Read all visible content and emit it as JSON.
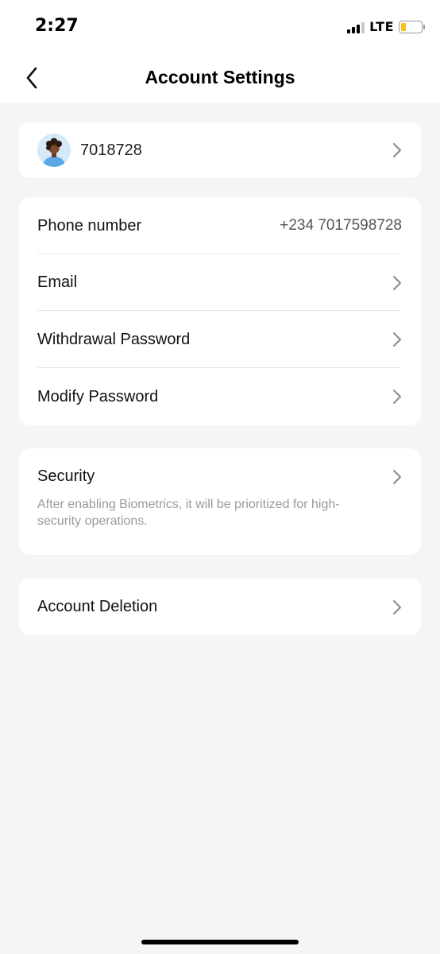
{
  "status_bar": {
    "time": "2:27",
    "network": "LTE",
    "battery_level": 0.25,
    "battery_color": "#f6c21a"
  },
  "nav": {
    "title": "Account Settings",
    "back_icon": "chevron-left-icon"
  },
  "profile": {
    "user_id": "7018728",
    "avatar_icon": "user-avatar-icon"
  },
  "account_details": {
    "phone_label": "Phone number",
    "phone_value": "+234 7017598728",
    "email_label": "Email",
    "withdrawal_password_label": "Withdrawal Password",
    "modify_password_label": "Modify Password"
  },
  "security": {
    "label": "Security",
    "description": "After enabling Biometrics, it will be prioritized for high-security operations."
  },
  "account_deletion": {
    "label": "Account Deletion"
  },
  "colors": {
    "page_background": "#f5f5f5",
    "card_background": "#ffffff",
    "secondary_text": "#9a9a9a"
  }
}
